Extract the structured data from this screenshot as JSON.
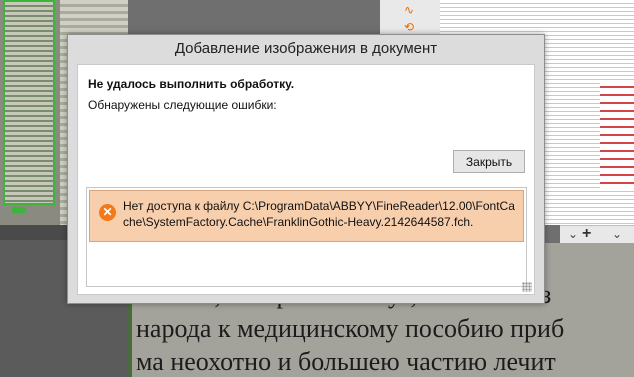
{
  "dialog": {
    "title": "Добавление изображения в документ",
    "heading": "Не удалось выполнить обработку.",
    "subheading": "Обнаружены следующие ошибки:",
    "close_label": "Закрыть",
    "errors": [
      {
        "icon": "error-x-icon",
        "glyph": "✕",
        "text": "Нет доступа к файлу C:\\ProgramData\\ABBYY\\FineReader\\12.00\\FontCache\\SystemFactory.Cache\\FranklinGothic-Heavy.2142644587.fch."
      }
    ]
  },
  "background": {
    "scan_lines": [
      "России, наверное скажут, что там низ",
      "народа к медицинскому пособию приб",
      "ма неохотно и большею частию лечит"
    ],
    "tab_glyphs": {
      "chevron": "⌄",
      "add": "+",
      "more": "⌄"
    },
    "tool_glyphs": [
      "∿",
      "⟲"
    ]
  },
  "colors": {
    "error_bg": "#f8cfad",
    "error_icon": "#f07a1c",
    "thumb_border": "#3db53d"
  }
}
